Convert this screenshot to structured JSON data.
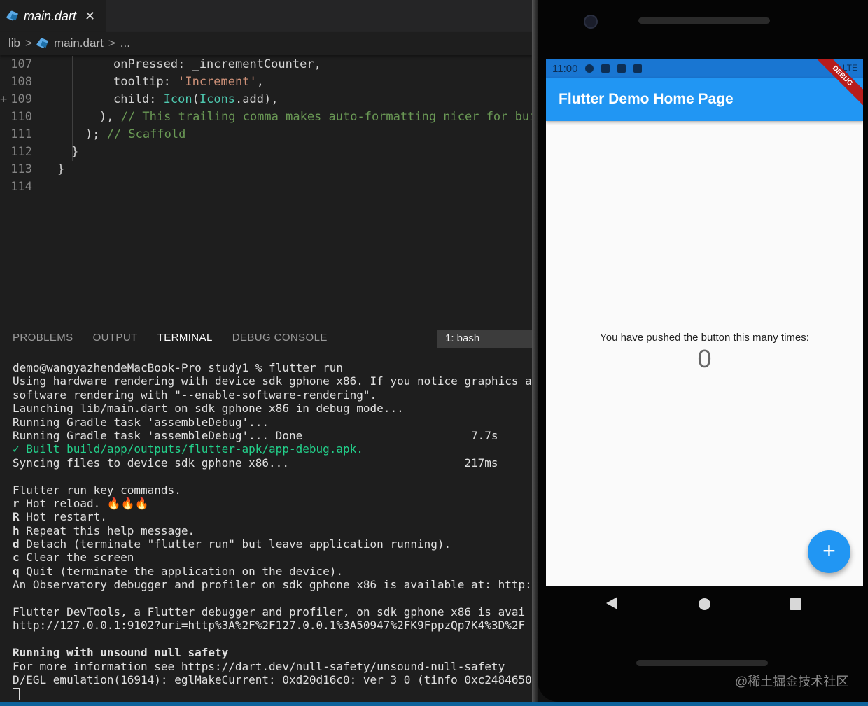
{
  "editor": {
    "tab_label": "main.dart",
    "close_glyph": "✕",
    "breadcrumb": {
      "folder": "lib",
      "file": "main.dart",
      "more": "...",
      "sep": ">"
    },
    "code_lines": [
      {
        "n": "107",
        "parts": [
          [
            "",
            "onPressed: _incrementCounter,"
          ]
        ]
      },
      {
        "n": "108",
        "parts": [
          [
            "",
            "tooltip: "
          ],
          [
            "str",
            "'Increment'"
          ],
          [
            "",
            ","
          ]
        ]
      },
      {
        "n": "109",
        "fold": "+",
        "parts": [
          [
            "",
            "child: "
          ],
          [
            "type",
            "Icon"
          ],
          [
            "",
            "("
          ],
          [
            "type",
            "Icons"
          ],
          [
            "",
            ".add),"
          ]
        ]
      },
      {
        "n": "110",
        "parts": [
          [
            "",
            "), "
          ],
          [
            "com",
            "// This trailing comma makes auto-formatting nicer for buil"
          ]
        ]
      },
      {
        "n": "111",
        "parts": [
          [
            "",
            "); "
          ],
          [
            "com",
            "// Scaffold"
          ]
        ]
      },
      {
        "n": "112",
        "parts": [
          [
            "",
            "}"
          ]
        ]
      },
      {
        "n": "113",
        "parts": [
          [
            "",
            "}"
          ]
        ]
      },
      {
        "n": "114",
        "parts": [
          [
            "",
            ""
          ]
        ]
      }
    ]
  },
  "panel": {
    "tabs": [
      "PROBLEMS",
      "OUTPUT",
      "TERMINAL",
      "DEBUG CONSOLE"
    ],
    "active_tab": "TERMINAL",
    "terminal_select": "1: bash"
  },
  "terminal": {
    "lines": [
      {
        "text": "demo@wangyazhendeMacBook-Pro study1 % flutter run"
      },
      {
        "text": "Using hardware rendering with device sdk gphone x86. If you notice graphics a"
      },
      {
        "text": "software rendering with \"--enable-software-rendering\"."
      },
      {
        "text": "Launching lib/main.dart on sdk gphone x86 in debug mode..."
      },
      {
        "text": "Running Gradle task 'assembleDebug'..."
      },
      {
        "text": "Running Gradle task 'assembleDebug'... Done                         7.7s"
      },
      {
        "text": "✓ Built build/app/outputs/flutter-apk/app-debug.apk.",
        "style": "green"
      },
      {
        "text": "Syncing files to device sdk gphone x86...                          217ms"
      },
      {
        "text": ""
      },
      {
        "text": "Flutter run key commands."
      },
      {
        "key": "r",
        "text": " Hot reload. ",
        "emoji": "🔥🔥🔥"
      },
      {
        "key": "R",
        "text": " Hot restart."
      },
      {
        "key": "h",
        "text": " Repeat this help message."
      },
      {
        "key": "d",
        "text": " Detach (terminate \"flutter run\" but leave application running)."
      },
      {
        "key": "c",
        "text": " Clear the screen"
      },
      {
        "key": "q",
        "text": " Quit (terminate the application on the device)."
      },
      {
        "text": "An Observatory debugger and profiler on sdk gphone x86 is available at: http:"
      },
      {
        "text": ""
      },
      {
        "text": "Flutter DevTools, a Flutter debugger and profiler, on sdk gphone x86 is avai"
      },
      {
        "text": "http://127.0.0.1:9102?uri=http%3A%2F%2F127.0.0.1%3A50947%2FK9FppzQp7K4%3D%2F"
      },
      {
        "text": ""
      },
      {
        "text": "Running with unsound null safety",
        "style": "bold"
      },
      {
        "text": "For more information see https://dart.dev/null-safety/unsound-null-safety"
      },
      {
        "text": "D/EGL_emulation(16914): eglMakeCurrent: 0xd20d16c0: ver 3 0 (tinfo 0xc2484650"
      }
    ]
  },
  "phone": {
    "status_time": "11:00",
    "status_right": "LTE",
    "debug_banner": "DEBUG",
    "appbar_title": "Flutter Demo Home Page",
    "counter_label": "You have pushed the button this many times:",
    "counter_value": "0",
    "fab_glyph": "+",
    "fab_tooltip": "Increment"
  },
  "watermark": "@稀土掘金技术社区",
  "colors": {
    "appbar": "#2196f3",
    "status_bar": "#1976d2",
    "terminal_green": "#23d18b",
    "string": "#ce9178",
    "type": "#4ec9b0",
    "comment": "#6a9955"
  }
}
